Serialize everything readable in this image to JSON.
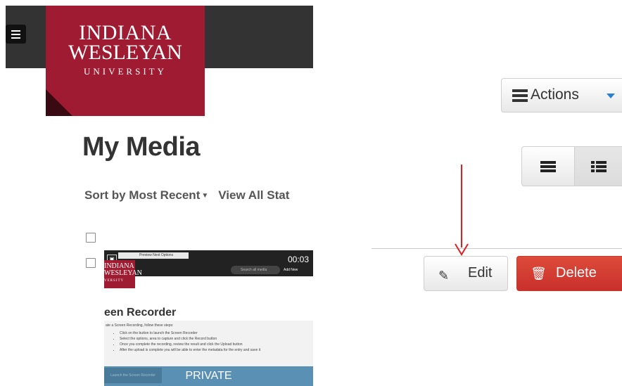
{
  "header": {
    "menu_icon": "hamburger-icon",
    "logo": {
      "line1": "INDIANA",
      "line2": "WESLEYAN",
      "line3": "UNIVERSITY"
    }
  },
  "page": {
    "title": "My Media"
  },
  "sortbar": {
    "sort_label": "Sort by Most Recent",
    "status_label": "View All Stat"
  },
  "toolbar": {
    "actions_label": "Actions",
    "actions_icon": "actions-icon"
  },
  "view_toggle": {
    "detailed_icon": "list-detailed-icon",
    "compact_icon": "list-compact-icon"
  },
  "entry": {
    "thumbnail": {
      "duration": "00:03",
      "toolbar_text": "Preview Next Options",
      "logo_line1": "INDIANA",
      "logo_line2": "WESLEYAN",
      "logo_line3": "VERSITY",
      "search_placeholder": "Search all media",
      "add_new": "Add New",
      "heading": "een Recorder",
      "intro": "ate a Screen Recording, follow these steps:",
      "steps": [
        "Click on the button to launch the Screen Recorder",
        "Select the options, area to capture and click the Record button",
        "Once you complete the recording, review the result and click the Upload button",
        "After the upload is complete you will be able to enter the metadata for the entry and save it"
      ],
      "launch_label": "Launch the Screen Recorder",
      "status": "PRIVATE"
    },
    "edit_label": "Edit",
    "delete_label": "Delete"
  },
  "colors": {
    "brand": "#9e1b32",
    "danger": "#d9534f",
    "annotation_arrow": "#e02020"
  }
}
